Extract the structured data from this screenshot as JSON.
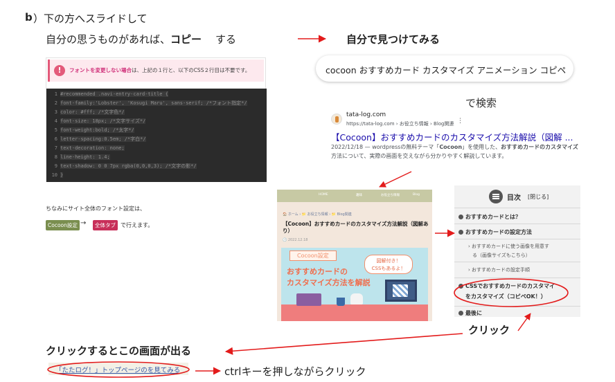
{
  "step": {
    "label": "b",
    "line1": "）下の方へスライドして",
    "line2_prefix": "自分の思うものがあれば、",
    "line2_bold": "コピー",
    "line2_suffix": "する",
    "find_yourself": "自分で見つけてみる"
  },
  "code_panel": {
    "warning_icon": "!",
    "warning_pink": "フォントを変更しない場合",
    "warning_rest": "は、上記の１行と、以下のCSS２行目は不要です。",
    "lines": [
      {
        "num": "1",
        "code": "#recommended .navi-entry-card-title {"
      },
      {
        "num": "2",
        "code": "font-family:'Lobster', 'Kosugi Maru', sans-serif; /*フォント指定*/"
      },
      {
        "num": "3",
        "code": "color: #fff; /*文字色*/"
      },
      {
        "num": "4",
        "code": "font-size: 18px; /*文字サイズ*/"
      },
      {
        "num": "5",
        "code": "font-weight:bold; /*太字*/"
      },
      {
        "num": "6",
        "code": "letter-spacing:0.5em; /*字白*/"
      },
      {
        "num": "7",
        "code": "text-decoration: none;"
      },
      {
        "num": "8",
        "code": "line-height: 1.4;"
      },
      {
        "num": "9",
        "code": "text-shadow: 0 0 7px rgba(0,0,0,3); /*文字の影*/"
      },
      {
        "num": "10",
        "code": "}"
      }
    ],
    "note": "ちなみにサイト全体のフォント設定は、",
    "btn_cocoon": "Cocoon設定",
    "btn_arrow": "→",
    "btn_all": "全体タブ",
    "btn_tail": "で行えます。"
  },
  "search": {
    "query": "cocoon おすすめカード カスタマイズ アニメーション コピペ",
    "search_label": "で検索"
  },
  "result": {
    "site_name": "tata-log.com",
    "crumb": "https://tata-log.com › お役立ち情報 › Blog関連",
    "menu": "⋮",
    "title": "【Cocoon】おすすめカードのカスタマイズ方法解説（図解 ...",
    "snippet_prefix": "2022/12/18 — wordpressの無料テーマ「",
    "snippet_b1": "Cocoon",
    "snippet_mid": "」を使用した、",
    "snippet_b2": "おすすめカードのカスタマイズ",
    "snippet_suffix": "方法について、実際の画面を交えながら分かりやすく解説しています。"
  },
  "article": {
    "nav": [
      "HOME",
      "趣味",
      "お役立ち情報",
      "Blog"
    ],
    "crumb": "🏠 ホーム › 📁 お役立ち情報 › 📁 Blog関連",
    "title": "【Cocoon】おすすめカードのカスタマイズ方法解説（図解あり）",
    "date": "🕓 2022.12.18",
    "img_tag": "Cocoon設定",
    "img_bubble1": "図解付き！",
    "img_bubble2": "CSSもあるよ！",
    "img_main1": "おすすめカードの",
    "img_main2": "カスタマイズ方法を解説"
  },
  "toc": {
    "title": "目次",
    "close": "[閉じる]",
    "item1": "おすすめカードとは？",
    "item2": "おすすめカードの設定方法",
    "sub1a": "› おすすめカードに使う画像を用意す",
    "sub1b": "る（画像サイズもこちら）",
    "sub2": "› おすすめカードの設定手順",
    "item3a": "CSSでおすすめカードのカスタマイ",
    "item3b": "をカスタマイズ（コピペOK！）",
    "item4": "最後に"
  },
  "labels": {
    "click": "クリック",
    "screen_appears": "クリックするとこの画面が出る",
    "bottom_link": "「たたログ！」トップページのを見てみる",
    "ctrl_click": "ctrlキーを押しながらクリック"
  },
  "colors": {
    "annotation_red": "#e31b1b",
    "link_blue": "#1a0dab",
    "pink": "#d0317a"
  }
}
